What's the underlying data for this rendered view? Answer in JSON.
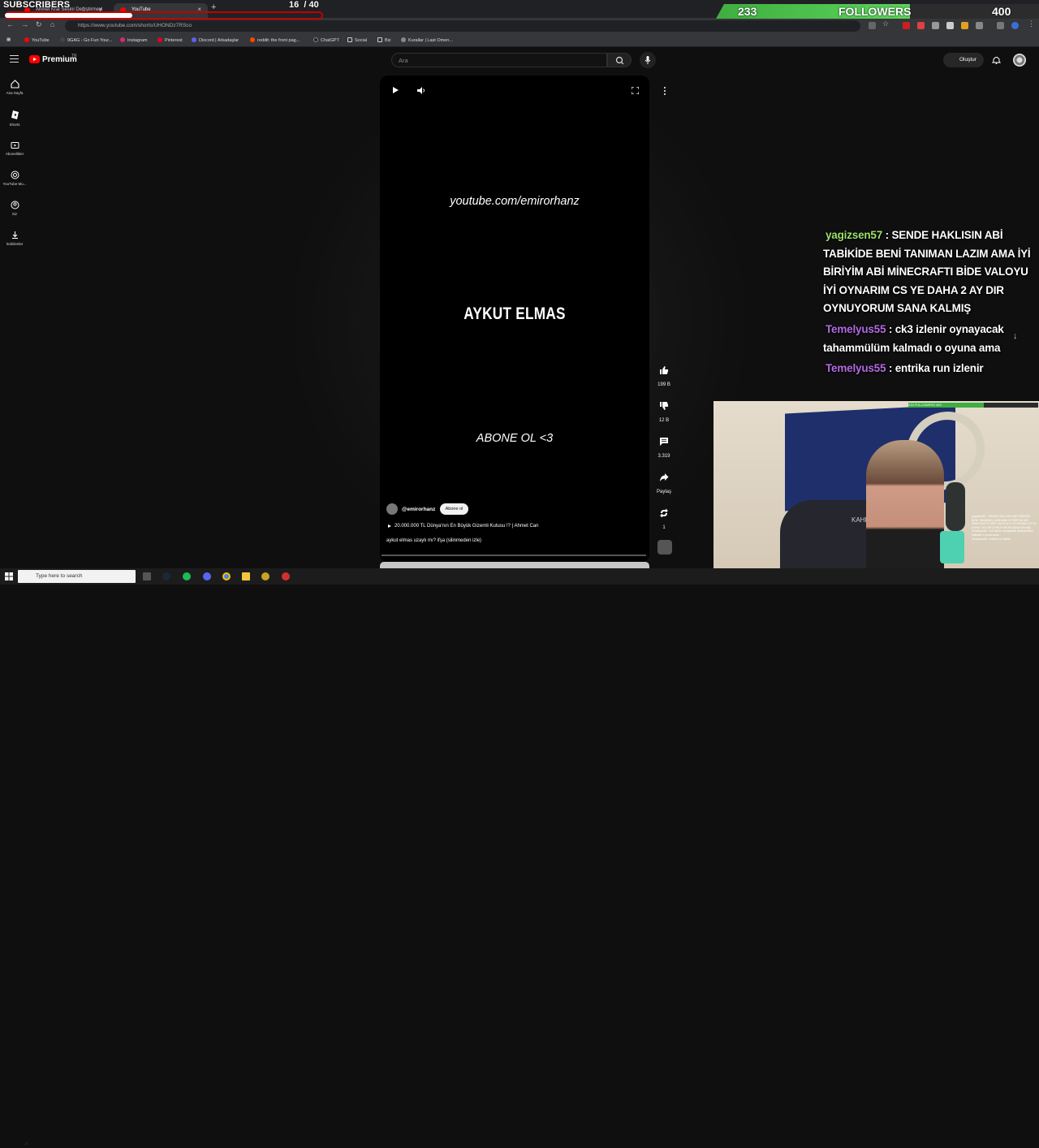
{
  "browser": {
    "tabs": [
      {
        "title": "Ahmet Kral Sesini Değiştirmeyi U..."
      },
      {
        "title": "YouTube"
      }
    ],
    "url": "https://www.youtube.com/shorts/UHONDz7RSco",
    "bookmarks": [
      "YouTube",
      "9GAG - Go Fun Your...",
      "Instagram",
      "Pinterest",
      "Discord | Arkadaşlar",
      "reddit: the front pag...",
      "ChatGPT",
      "Social",
      "Biz",
      "Kurallar | Last Omen..."
    ]
  },
  "overlay": {
    "subs_label": "SUBSCRIBERS",
    "subs_current": "16",
    "subs_goal": "/ 40",
    "subs_progress": 0.4,
    "followers_current": "233",
    "followers_label": "FOLLOWERS",
    "followers_goal": "400"
  },
  "youtube": {
    "brand": "Premium",
    "region": "TR",
    "search_placeholder": "Ara",
    "create_label": "Oluştur",
    "sidebar": [
      {
        "label": "Ana Sayfa",
        "icon": "home-icon"
      },
      {
        "label": "Shorts",
        "icon": "shorts-icon"
      },
      {
        "label": "Abonelikler",
        "icon": "subscriptions-icon"
      },
      {
        "label": "YouTube Mu...",
        "icon": "youtube-music-icon"
      },
      {
        "label": "Siz",
        "icon": "you-icon"
      },
      {
        "label": "İndirilenler",
        "icon": "download-icon"
      }
    ],
    "short": {
      "overlay_url": "youtube.com/emirorhanz",
      "overlay_name": "AYKUT ELMAS",
      "overlay_cta": "ABONE OL <3",
      "channel": "@emirorhanz",
      "subscribe_label": "Abone ol",
      "video_title": "20.000.000 TL Dünya'nın En Büyük Gizemli Kutusu !? | Ahmet Can",
      "description": "aykut elmas uzaylı mı? ifşa (silinmeden izle)"
    },
    "actions": {
      "likes": "199 B",
      "dislikes": "12 B",
      "comments": "3.319",
      "share": "Paylaş",
      "remix": "1"
    }
  },
  "chat": [
    {
      "user": "yagizsen57",
      "user_color": "#9be36b",
      "message": "SENDE HAKLISIN ABİ TABİKİDE BENİ TANIMAN LAZIM AMA İYİ BİRİYİM ABİ MİNECRAFTI BİDE VALOYU İYİ OYNARIM CS YE DAHA 2 AY DIR OYNUYORUM SANA KALMIŞ"
    },
    {
      "user": "Temelyus55",
      "user_color": "#b46be3",
      "message": "ck3 izlenir oynayacak tahammülüm kalmadı o oyuna ama"
    },
    {
      "user": "Temelyus55",
      "user_color": "#b46be3",
      "message": "entrika run izlenir"
    }
  ],
  "webcam": {
    "follow_mini": "233 FOLLOWERS 400",
    "subs_mini": "SUBSCRIBERS 16 / 40",
    "chair_text": "KAHRA"
  },
  "taskbar": {
    "search_placeholder": "Type here to search"
  }
}
